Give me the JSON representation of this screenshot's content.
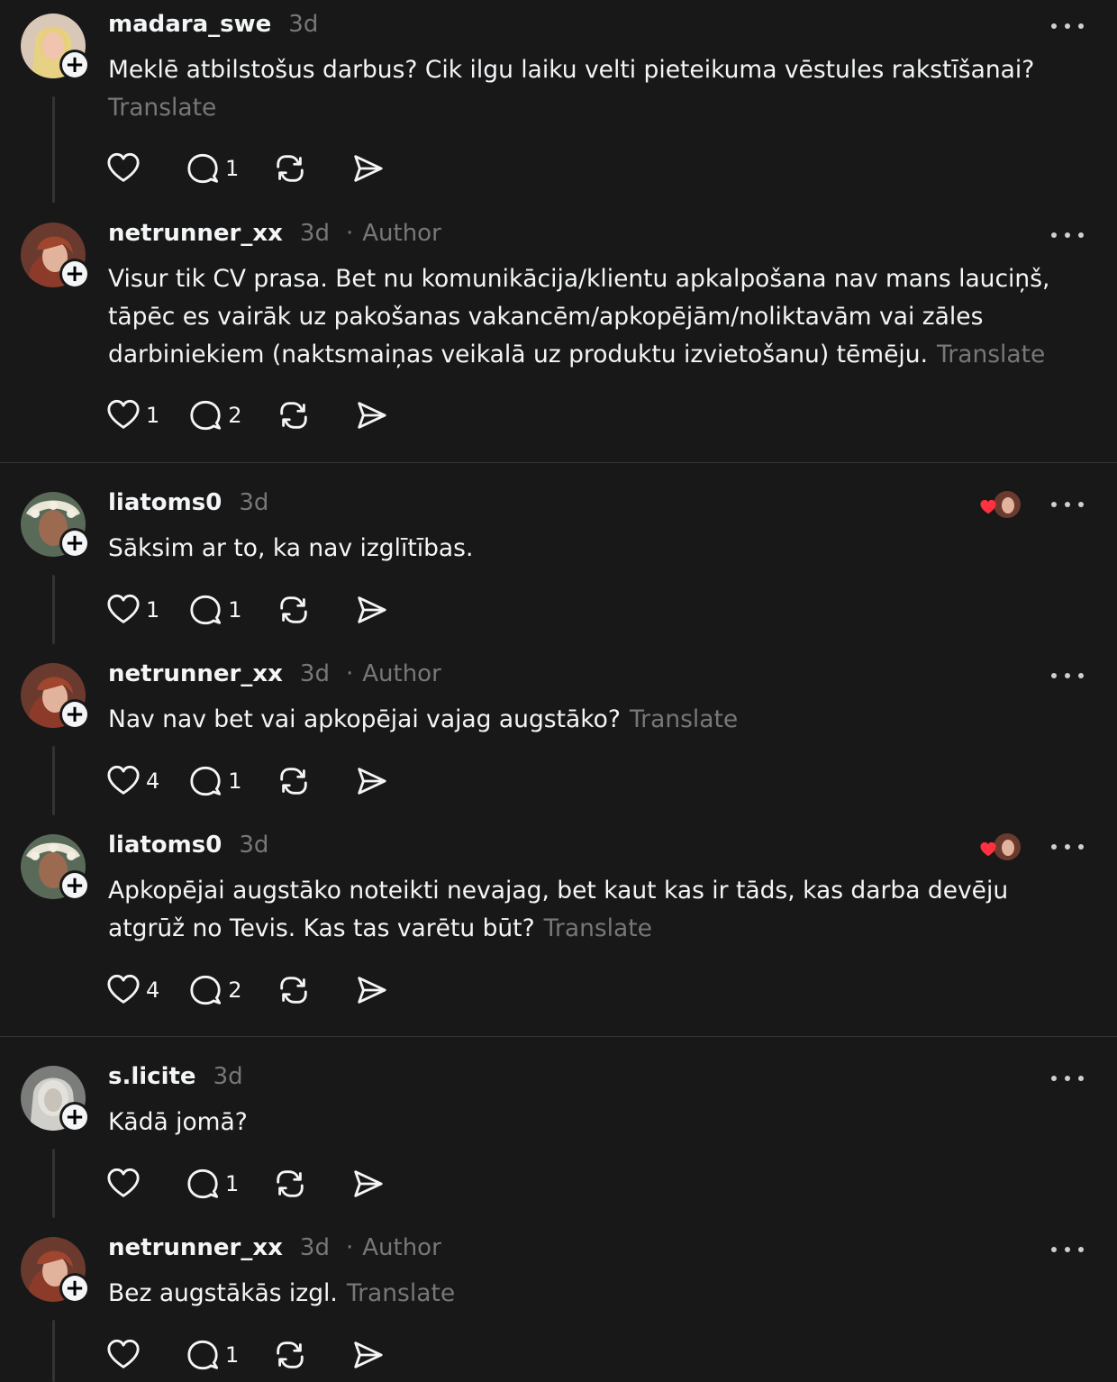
{
  "colors": {
    "background": "#181818",
    "text": "#f3f5f7",
    "muted": "#777777",
    "divider": "#333333",
    "like_heart": "#ff3040"
  },
  "labels": {
    "author": "Author",
    "separator": "·",
    "translate": "Translate"
  },
  "icons": {
    "like": "heart-icon",
    "reply": "comment-icon",
    "repost": "repost-icon",
    "share": "share-icon",
    "more": "more-icon",
    "follow": "plus-icon"
  },
  "posts": [
    {
      "username": "madara_swe",
      "time": "3d",
      "text": "Meklē atbilstošus darbus? Cik ilgu laiku velti pieteikuma vēstules rakstīšanai?",
      "likes": "",
      "replies": "1"
    },
    {
      "username": "netrunner_xx",
      "time": "3d",
      "text": "Visur tik CV prasa. Bet nu komunikācija/klientu apkalpošana nav mans lauciņš, tāpēc es vairāk uz pakošanas vakancēm/apkopējām/noliktavām vai zāles darbiniekiem (naktsmaiņas veikalā uz produktu izvietošanu) tēmēju.",
      "likes": "1",
      "replies": "2"
    },
    {
      "username": "liatoms0",
      "time": "3d",
      "text": "Sāksim ar to, ka nav izglītības.",
      "likes": "1",
      "replies": "1"
    },
    {
      "username": "netrunner_xx",
      "time": "3d",
      "text": "Nav nav bet vai apkopējai vajag augstāko?",
      "likes": "4",
      "replies": "1"
    },
    {
      "username": "liatoms0",
      "time": "3d",
      "text": "Apkopējai augstāko noteikti nevajag, bet kaut kas ir tāds, kas darba devēju atgrūž no Tevis. Kas tas varētu būt?",
      "likes": "4",
      "replies": "2"
    },
    {
      "username": "s.licite",
      "time": "3d",
      "text": "Kādā jomā?",
      "likes": "",
      "replies": "1"
    },
    {
      "username": "netrunner_xx",
      "time": "3d",
      "text": "Bez augstākās izgl.",
      "likes": "",
      "replies": "1"
    }
  ]
}
